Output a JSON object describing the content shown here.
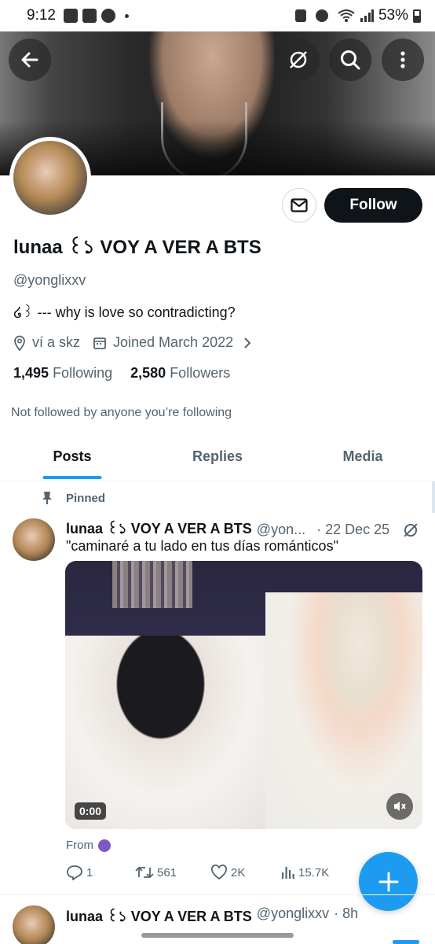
{
  "status_bar": {
    "time": "9:12",
    "battery": "53%"
  },
  "profile": {
    "follow_label": "Follow",
    "display_name": "lunaa ꒰১ VOY A VER A BTS",
    "handle": "@yonglixxv",
    "bio": "໒꒱ --- why is love so contradicting?",
    "location": "ví a skz",
    "joined": "Joined March 2022",
    "following_count": "1,495",
    "following_label": "Following",
    "followers_count": "2,580",
    "followers_label": "Followers",
    "not_followed": "Not followed by anyone you’re following"
  },
  "tabs": [
    "Posts",
    "Replies",
    "Media"
  ],
  "pinned_tweet": {
    "pinned_label": "Pinned",
    "display_name": "lunaa ꒰১ VOY A VER A BTS",
    "handle": "@yon...",
    "date": "· 22 Dec 25",
    "text": "\"caminaré a tu lado en tus días románticos\"",
    "video_time": "0:00",
    "from_label": "From",
    "replies": "1",
    "retweets": "561",
    "likes": "2K",
    "views": "15.7K"
  },
  "second_tweet": {
    "display_name": "lunaa ꒰১ VOY A VER A BTS",
    "handle": "@yonglixxv",
    "time": "· 8h"
  },
  "icons": {
    "back": "back-arrow-icon",
    "grok": "grok-icon",
    "search": "search-icon",
    "more": "more-vertical-icon",
    "message": "envelope-icon",
    "location": "location-pin-icon",
    "calendar": "calendar-icon",
    "pin": "pin-icon",
    "reply": "reply-icon",
    "retweet": "retweet-icon",
    "like": "heart-icon",
    "views": "views-icon",
    "compose": "plus-icon"
  },
  "colors": {
    "accent": "#1d9bf0",
    "text": "#0f1419",
    "muted": "#536471"
  }
}
